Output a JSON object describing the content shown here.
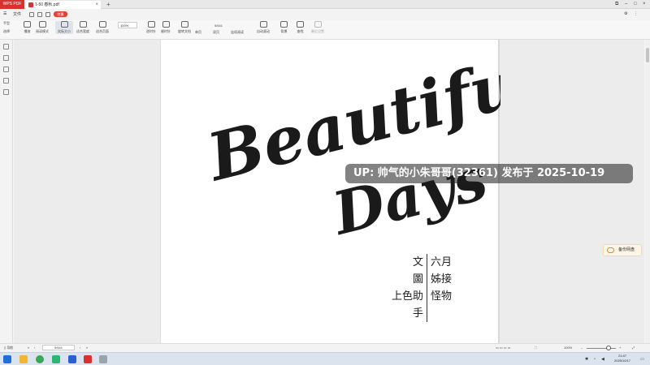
{
  "app": {
    "badge": "WPS PDF",
    "tab_title": "1-50 春秋.pdf"
  },
  "menu": {
    "file": "文件",
    "badge": "特惠"
  },
  "toolbar": {
    "hand": "手型",
    "select": "选择",
    "play": "播放",
    "reading_mode": "阅读模式",
    "actual_size": "实际大小",
    "fit_width": "适合宽度",
    "fit_page": "适合页面",
    "zoom_value": "100%",
    "rotate_left": "左转",
    "rotate_right": "右转",
    "rotate_left_label": "逆时针",
    "rotate_right_label": "顺时针",
    "rotate_doc": "旋转文档",
    "page_indicator": "5/641",
    "single": "单页",
    "double": "双页",
    "continuous": "连续阅读",
    "auto_scroll": "自动滚动",
    "background": "背景",
    "search": "查找",
    "settings": "最近设置"
  },
  "page_content": {
    "title_word1": "Beautiful",
    "title_word2": "Days",
    "credits": [
      {
        "role": "文",
        "name": "六月"
      },
      {
        "role": "圖",
        "name": "姊接"
      },
      {
        "role": "上色助手",
        "name": "怪物"
      }
    ]
  },
  "overlay": {
    "text": "UP: 帅气的小朱哥哥(32361) 发布于 2025-10-19"
  },
  "cloud_button": {
    "label": "备份网盘"
  },
  "status": {
    "nav_label": "导航",
    "page": "5/641",
    "zoom": "100%"
  },
  "clock": {
    "time": "21:47",
    "date": "2025/10/17"
  },
  "colors": {
    "brand_red": "#d9322e",
    "page_bg": "#ffffff",
    "ink": "#1a1a1a"
  }
}
